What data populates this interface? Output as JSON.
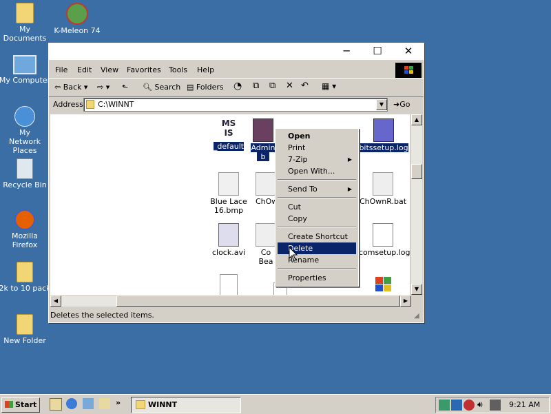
{
  "desktop_icons": [
    {
      "label": "My Documents",
      "icon": "folder-documents-icon"
    },
    {
      "label": "K-Meleon 74",
      "icon": "k-meleon-icon"
    },
    {
      "label": "My Computer",
      "icon": "computer-icon"
    },
    {
      "label": "My Network Places",
      "icon": "network-icon"
    },
    {
      "label": "Recycle Bin",
      "icon": "recycle-bin-icon"
    },
    {
      "label": "Mozilla Firefox",
      "icon": "firefox-icon"
    },
    {
      "label": "2k to 10 pack",
      "icon": "folder-icon"
    },
    {
      "label": "New Folder",
      "icon": "folder-icon"
    }
  ],
  "window": {
    "menu": [
      "File",
      "Edit",
      "View",
      "Favorites",
      "Tools",
      "Help"
    ],
    "toolbar": {
      "back": "Back",
      "search": "Search",
      "folders": "Folders",
      "go": "Go"
    },
    "address_label": "Address",
    "address_value": "C:\\WINNT",
    "status_text": "Deletes the selected items.",
    "files": [
      {
        "label": "_default",
        "selected": true
      },
      {
        "label": "Admin",
        "label2": "b",
        "selected": true
      },
      {
        "label": "bitssetup.log",
        "selected": true
      },
      {
        "label": "Blue Lace",
        "label2": "16.bmp",
        "selected": false
      },
      {
        "label": "ChOw",
        "selected": false
      },
      {
        "label": "ChOwnR.bat",
        "selected": false
      },
      {
        "label": "clock.avi",
        "selected": false
      },
      {
        "label": "Co",
        "label2": "Bea",
        "selected": false
      },
      {
        "label": "comsetup.log",
        "selected": false
      }
    ]
  },
  "context_menu": {
    "items": [
      "Open",
      "Print",
      "7-Zip",
      "Open With...",
      "Send To",
      "Cut",
      "Copy",
      "Create Shortcut",
      "Delete",
      "Rename",
      "Properties"
    ],
    "highlighted": "Delete"
  },
  "taskbar": {
    "start": "Start",
    "task": "WINNT",
    "clock": "9:21 AM"
  },
  "colors": {
    "desktop": "#3a6ea5",
    "selection": "#0a246a",
    "face": "#d4d0c8"
  }
}
